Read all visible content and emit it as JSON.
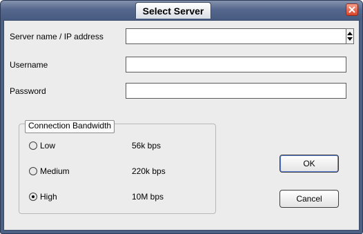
{
  "window": {
    "title": "Select Server"
  },
  "form": {
    "server_label": "Server name / IP address",
    "server_value": "",
    "username_label": "Username",
    "username_value": "",
    "password_label": "Password",
    "password_value": ""
  },
  "bandwidth": {
    "group_label": "Connection Bandwidth",
    "options": [
      {
        "label": "Low",
        "rate": "56k bps",
        "selected": false
      },
      {
        "label": "Medium",
        "rate": "220k bps",
        "selected": false
      },
      {
        "label": "High",
        "rate": "10M bps",
        "selected": true
      }
    ]
  },
  "buttons": {
    "ok": "OK",
    "cancel": "Cancel"
  },
  "icons": {
    "close": "close-icon",
    "spinner": "spinner-icon"
  },
  "colors": {
    "titlebar": "#55678d",
    "close": "#d9432a",
    "client": "#ececec"
  }
}
